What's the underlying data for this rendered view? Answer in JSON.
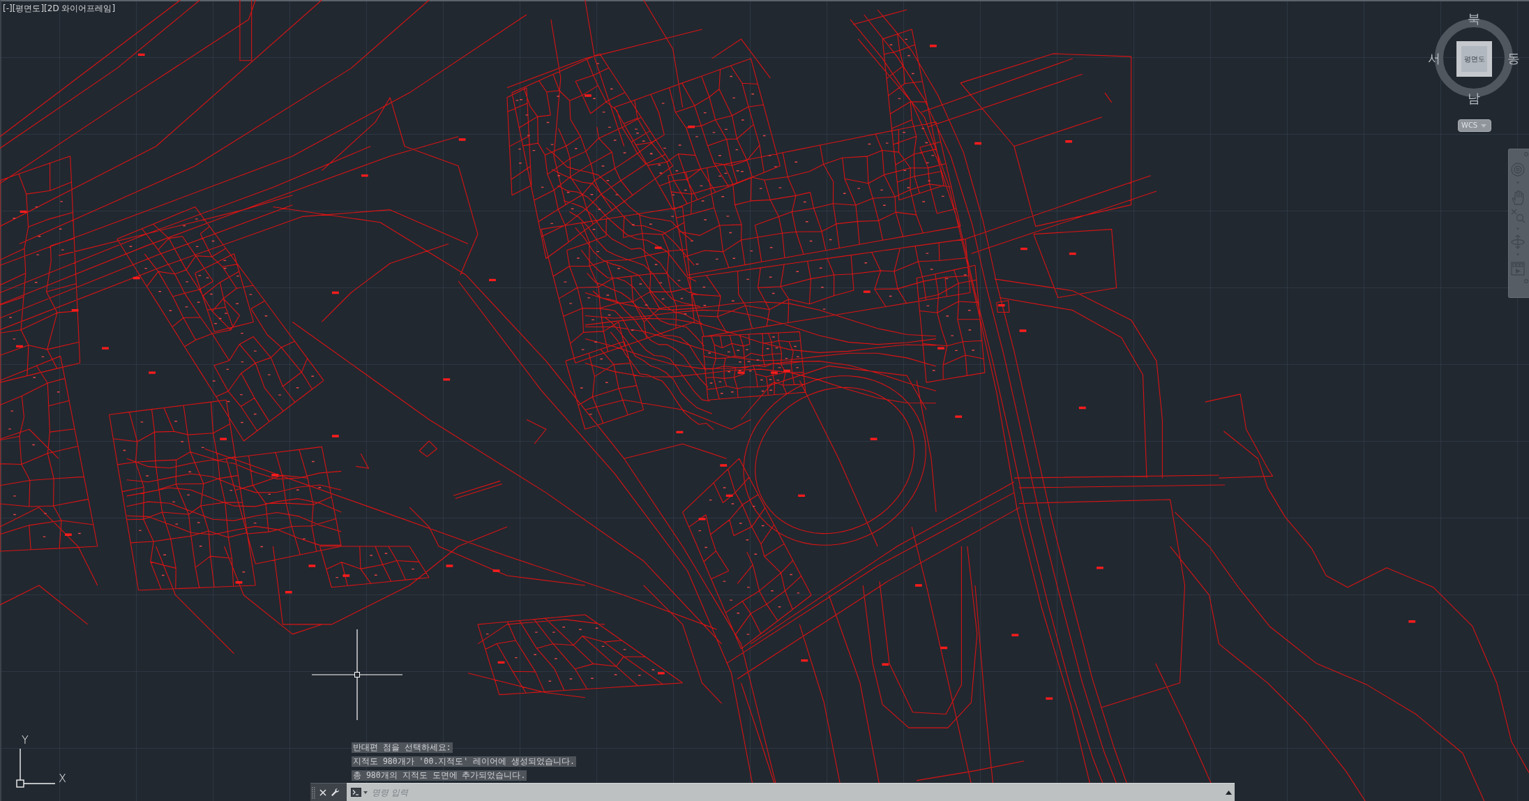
{
  "viewport_controls": [
    {
      "label": "[-]"
    },
    {
      "label": "[평면도]"
    },
    {
      "label": "[2D 와이어프레임]"
    }
  ],
  "viewcube": {
    "north": "북",
    "west": "서",
    "east": "동",
    "south": "남",
    "face": "평면도",
    "coordinate_system": "WCS"
  },
  "navigation_bar": {
    "tools": [
      {
        "kind": "wheel"
      },
      {
        "kind": "pan"
      },
      {
        "kind": "zoom"
      },
      {
        "kind": "orbit"
      },
      {
        "kind": "showmotion"
      }
    ]
  },
  "ucs_icon": {
    "x_label": "X",
    "y_label": "Y"
  },
  "command_history": [
    "반대편 점을 선택하세요:",
    "지적도 980개가 '00.지적도' 레이어에 생성되었습니다.",
    "총 980개의 지적도 도면에 추가되었습니다."
  ],
  "command_line": {
    "placeholder": "명령 입력"
  }
}
